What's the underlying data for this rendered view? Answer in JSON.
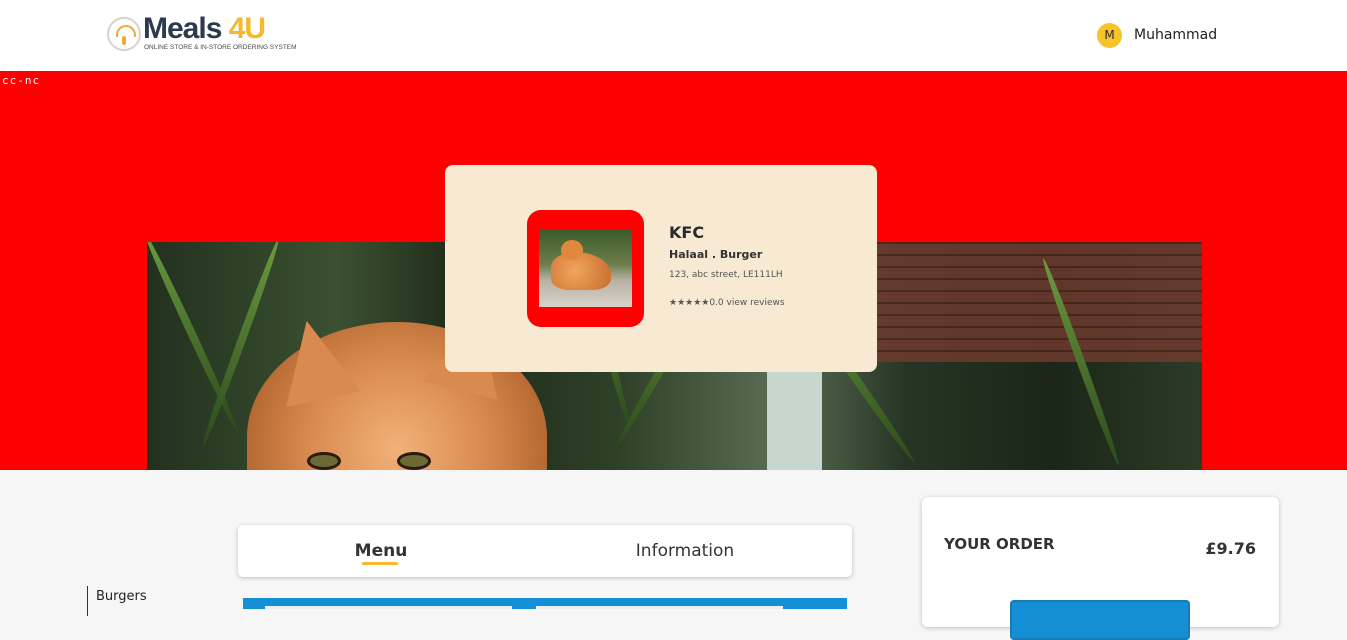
{
  "header": {
    "logo_main": "Meals ",
    "logo_accent": "4U",
    "logo_tagline": "ONLINE STORE & IN-STORE ORDERING SYSTEM",
    "user_initial": "M",
    "user_name": "Muhammad"
  },
  "hero": {
    "badge": "cc-nc"
  },
  "restaurant": {
    "name": "KFC",
    "cuisine": "Halaal . Burger",
    "address": "123, abc street, LE111LH",
    "rating": "★★★★★0.0 view reviews"
  },
  "categories": [
    "Burgers"
  ],
  "tabs": [
    {
      "label": "Menu",
      "active": true
    },
    {
      "label": "Information",
      "active": false
    }
  ],
  "order": {
    "title": "YOUR ORDER",
    "total": "£9.76"
  },
  "colors": {
    "hero_background": "#ff0000",
    "accent": "#f5b82e",
    "primary": "#148fd6",
    "card_background": "#f7e9d2"
  }
}
